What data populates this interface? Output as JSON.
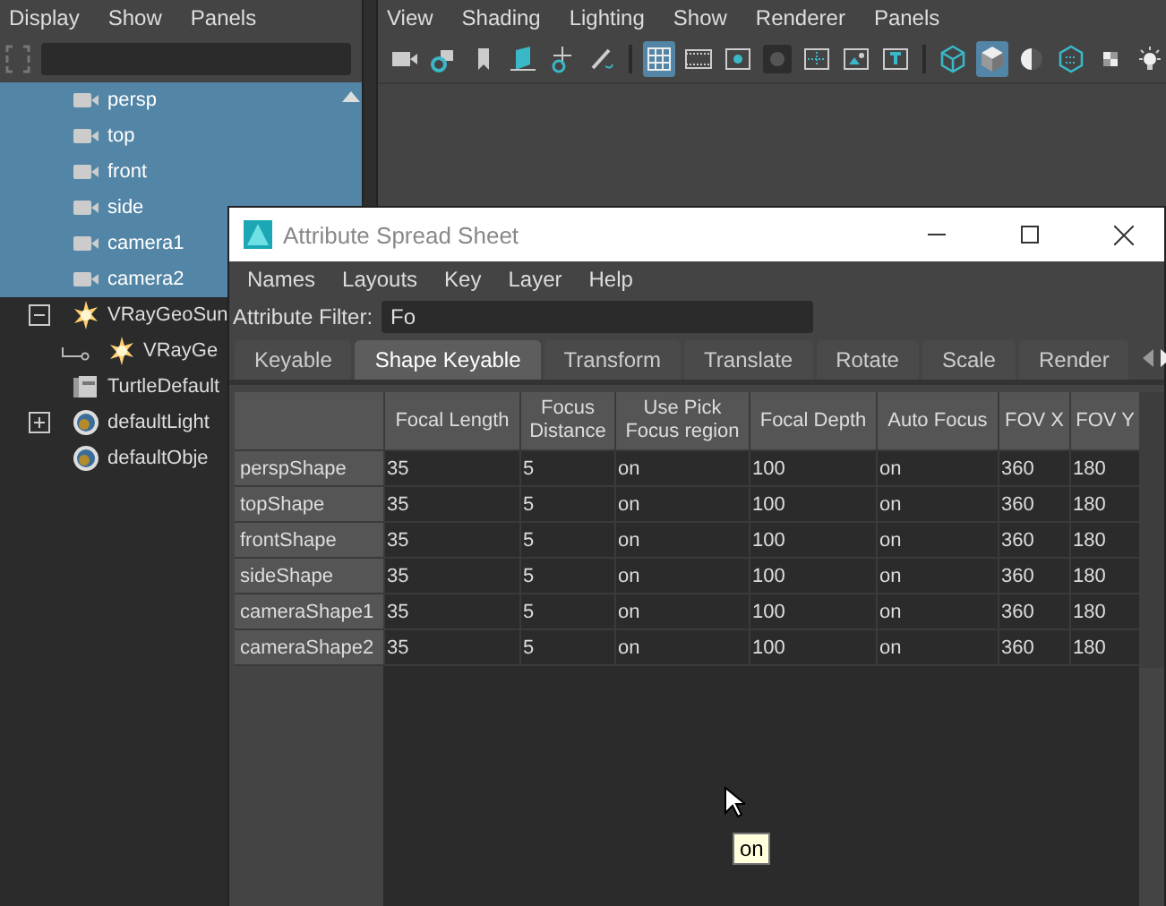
{
  "outliner": {
    "menu": [
      "Display",
      "Show",
      "Panels"
    ],
    "items": [
      {
        "label": "persp",
        "kind": "camera",
        "selected": true
      },
      {
        "label": "top",
        "kind": "camera",
        "selected": true
      },
      {
        "label": "front",
        "kind": "camera",
        "selected": true
      },
      {
        "label": "side",
        "kind": "camera",
        "selected": true
      },
      {
        "label": "camera1",
        "kind": "camera",
        "selected": true
      },
      {
        "label": "camera2",
        "kind": "camera",
        "selected": true
      },
      {
        "label": "VRayGeoSun",
        "kind": "sun",
        "selected": false,
        "expanded": true,
        "children": [
          {
            "label": "VRayGe",
            "kind": "sun",
            "selected": false
          }
        ]
      },
      {
        "label": "TurtleDefault",
        "kind": "stack",
        "selected": false
      },
      {
        "label": "defaultLight",
        "kind": "sphere",
        "selected": false,
        "expanded": false
      },
      {
        "label": "defaultObje",
        "kind": "sphere",
        "selected": false
      }
    ]
  },
  "viewport": {
    "menu": [
      "View",
      "Shading",
      "Lighting",
      "Show",
      "Renderer",
      "Panels"
    ],
    "toolbar": [
      {
        "kind": "camera",
        "selected": false
      },
      {
        "kind": "camera-gear",
        "selected": false
      },
      {
        "kind": "bookmark",
        "selected": false
      },
      {
        "kind": "plane",
        "selected": false
      },
      {
        "kind": "move",
        "selected": false
      },
      {
        "kind": "brush",
        "selected": false
      },
      {
        "kind": "separator"
      },
      {
        "kind": "grid",
        "selected": true
      },
      {
        "kind": "film",
        "selected": false
      },
      {
        "kind": "square-dot",
        "selected": false
      },
      {
        "kind": "circle",
        "selected": false
      },
      {
        "kind": "dotted-square",
        "selected": false
      },
      {
        "kind": "image",
        "selected": false
      },
      {
        "kind": "t-square",
        "selected": false
      },
      {
        "kind": "separator"
      },
      {
        "kind": "wire-cube",
        "selected": false
      },
      {
        "kind": "cube",
        "selected": true
      },
      {
        "kind": "half-circle",
        "selected": false
      },
      {
        "kind": "dotted-cube",
        "selected": false
      },
      {
        "kind": "checker",
        "selected": false
      },
      {
        "kind": "bulb",
        "selected": false
      }
    ]
  },
  "window": {
    "title": "Attribute Spread Sheet",
    "menu": [
      "Names",
      "Layouts",
      "Key",
      "Layer",
      "Help"
    ],
    "filter": {
      "label": "Attribute Filter:",
      "value": "Fo"
    },
    "tabs": [
      {
        "label": "Keyable",
        "selected": false
      },
      {
        "label": "Shape Keyable",
        "selected": true
      },
      {
        "label": "Transform",
        "selected": false
      },
      {
        "label": "Translate",
        "selected": false
      },
      {
        "label": "Rotate",
        "selected": false
      },
      {
        "label": "Scale",
        "selected": false
      },
      {
        "label": "Render",
        "selected": false
      }
    ],
    "table": {
      "columns": [
        "Focal Length",
        "Focus\nDistance",
        "Use Pick\nFocus region",
        "Focal Depth",
        "Auto Focus",
        "FOV X",
        "FOV Y"
      ],
      "rows": [
        {
          "name": "perspShape",
          "cells": [
            "35",
            "5",
            "on",
            "100",
            "on",
            "360",
            "180"
          ]
        },
        {
          "name": "topShape",
          "cells": [
            "35",
            "5",
            "on",
            "100",
            "on",
            "360",
            "180"
          ]
        },
        {
          "name": "frontShape",
          "cells": [
            "35",
            "5",
            "on",
            "100",
            "on",
            "360",
            "180"
          ]
        },
        {
          "name": "sideShape",
          "cells": [
            "35",
            "5",
            "on",
            "100",
            "on",
            "360",
            "180"
          ]
        },
        {
          "name": "cameraShape1",
          "cells": [
            "35",
            "5",
            "on",
            "100",
            "on",
            "360",
            "180"
          ]
        },
        {
          "name": "cameraShape2",
          "cells": [
            "35",
            "5",
            "on",
            "100",
            "on",
            "360",
            "180"
          ]
        }
      ]
    },
    "tooltip": "on"
  }
}
